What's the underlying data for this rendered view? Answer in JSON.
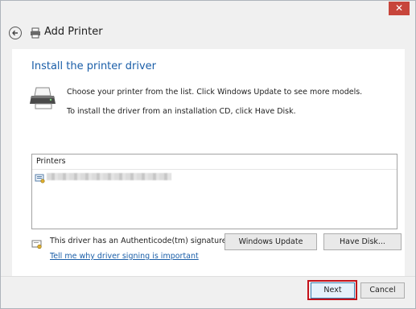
{
  "window": {
    "close_glyph": "✕",
    "title": "Add Printer"
  },
  "content": {
    "heading": "Install the printer driver",
    "description_1": "Choose your printer from the list. Click Windows Update to see more models.",
    "description_2": "To install the driver from an installation CD, click Have Disk."
  },
  "printer_list": {
    "header": "Printers",
    "items": [
      {
        "icon": "printer-driver-icon",
        "label_obscured": true
      }
    ]
  },
  "signature": {
    "text": "This driver has an Authenticode(tm) signature.",
    "link": "Tell me why driver signing is important"
  },
  "buttons": {
    "windows_update": "Windows Update",
    "have_disk": "Have Disk...",
    "next": "Next",
    "cancel": "Cancel"
  },
  "colors": {
    "accent_link": "#1a5ea8",
    "close_button": "#c7453b",
    "highlight": "#c4121b"
  }
}
